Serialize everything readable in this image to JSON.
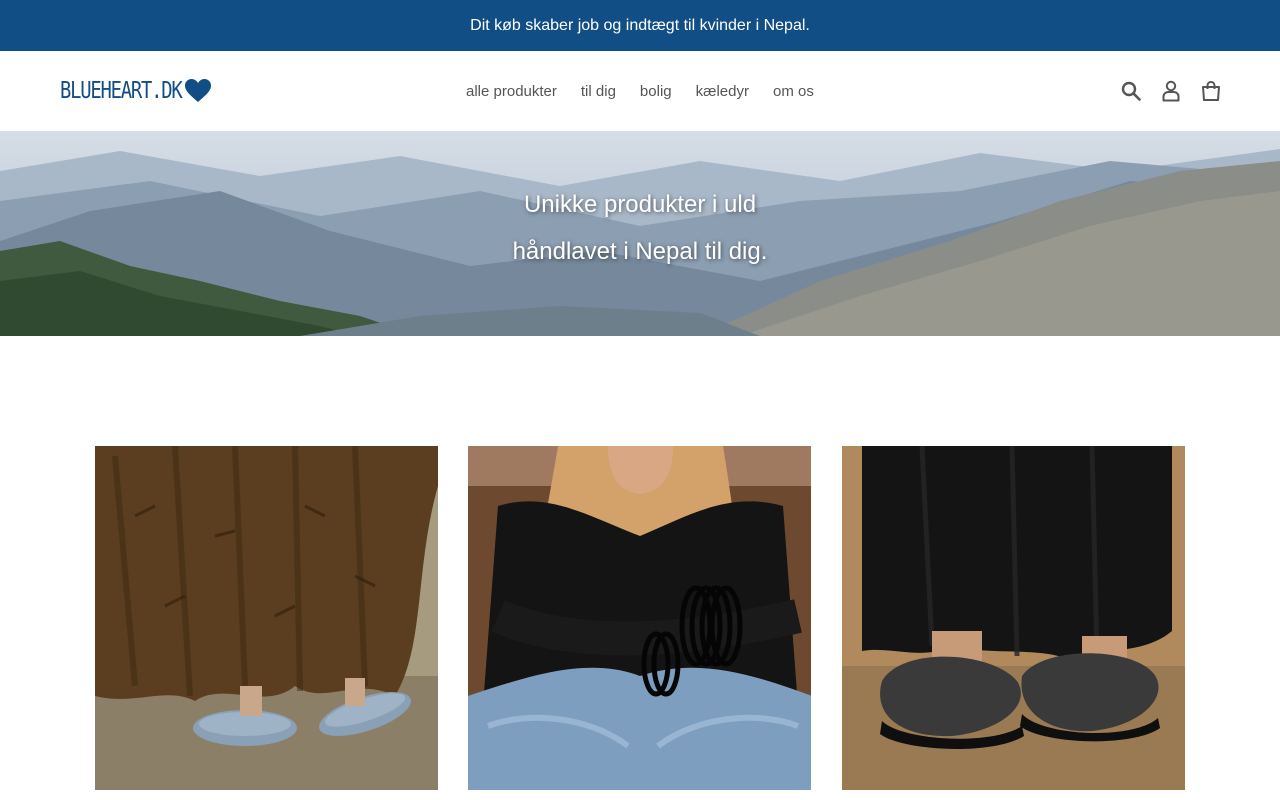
{
  "announcement": {
    "text": "Dit køb skaber job og indtægt til kvinder i Nepal."
  },
  "header": {
    "logo_text": "BLUEHEART.DK",
    "nav": [
      {
        "label": "alle produkter"
      },
      {
        "label": "til dig"
      },
      {
        "label": "bolig"
      },
      {
        "label": "kæledyr"
      },
      {
        "label": "om os"
      }
    ],
    "icons": [
      "search-icon",
      "account-icon",
      "cart-icon"
    ]
  },
  "hero": {
    "line1": "Unikke produkter i uld",
    "line2": "håndlavet i Nepal til dig."
  },
  "products": [
    {
      "image": "grey-felt-slippers-brown-skirt"
    },
    {
      "image": "black-felt-bangles-jeans"
    },
    {
      "image": "charcoal-felt-slippers-black-trousers"
    }
  ],
  "colors": {
    "brand_blue": "#124e86",
    "nav_text": "#555555",
    "icon": "#555555"
  }
}
